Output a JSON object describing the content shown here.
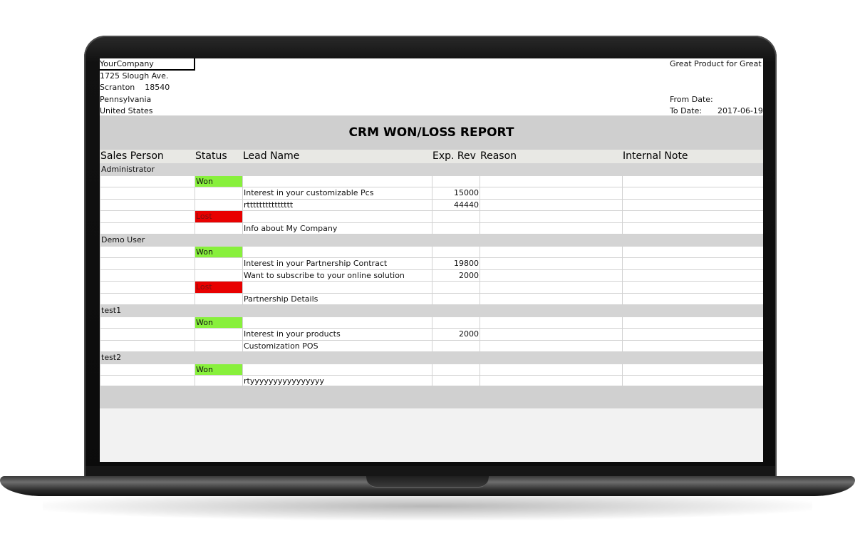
{
  "header": {
    "company_lines": [
      "YourCompany",
      "1725 Slough Ave.",
      "Scranton    18540",
      "Pennsylvania",
      "United States"
    ],
    "tagline": "Great Product for Great",
    "from_date_label": "From Date:",
    "to_date_label": "To Date:",
    "to_date_value": "2017-06-19"
  },
  "report": {
    "title": "CRM WON/LOSS REPORT",
    "columns": {
      "sales_person": "Sales Person",
      "status": "Status",
      "lead_name": "Lead Name",
      "exp_rev": "Exp. Rev",
      "reason": "Reason",
      "internal_note": "Internal Note"
    },
    "rows": [
      {
        "type": "group",
        "name": "Administrator"
      },
      {
        "type": "status",
        "status": "Won"
      },
      {
        "type": "lead",
        "lead": "Interest in your customizable Pcs",
        "rev": "15000"
      },
      {
        "type": "lead",
        "lead": "rttttttttttttttt",
        "rev": "44440"
      },
      {
        "type": "status",
        "status": "Lost"
      },
      {
        "type": "lead",
        "lead": "Info about My Company",
        "rev": ""
      },
      {
        "type": "group",
        "name": "Demo User"
      },
      {
        "type": "status",
        "status": "Won"
      },
      {
        "type": "lead",
        "lead": "Interest in your Partnership Contract",
        "rev": "19800"
      },
      {
        "type": "lead",
        "lead": "Want to subscribe to your online solution",
        "rev": "2000"
      },
      {
        "type": "status",
        "status": "Lost"
      },
      {
        "type": "lead",
        "lead": "Partnership Details",
        "rev": ""
      },
      {
        "type": "group",
        "name": "test1"
      },
      {
        "type": "status",
        "status": "Won"
      },
      {
        "type": "lead",
        "lead": "Interest in your products",
        "rev": "2000"
      },
      {
        "type": "lead",
        "lead": "Customization POS",
        "rev": ""
      },
      {
        "type": "group",
        "name": "test2"
      },
      {
        "type": "status",
        "status": "Won"
      },
      {
        "type": "lead",
        "lead": "rtyyyyyyyyyyyyyyyy",
        "rev": ""
      }
    ]
  }
}
